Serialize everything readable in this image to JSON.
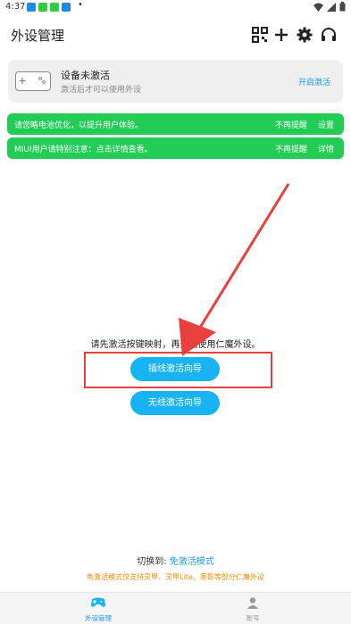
{
  "status_bar": {
    "time": "4:37",
    "app_colors": [
      "#1e88e5",
      "#2ecc40",
      "#2ecc40",
      "#1e88e5"
    ],
    "dot": "•",
    "right_icons": [
      "wifi-icon",
      "signal-icon",
      "battery-icon"
    ]
  },
  "header": {
    "title": "外设管理",
    "icons": [
      "qr-scan-icon",
      "add-icon",
      "gear-icon",
      "headset-icon"
    ]
  },
  "device_card": {
    "title": "设备未激活",
    "subtitle": "激活后才可以使用外设",
    "action": "开启激活",
    "icon": "gamepad-icon"
  },
  "banners": [
    {
      "message": "请您略电池优化，以提升用户体验。",
      "dismiss": "不再提醒",
      "action": "设置"
    },
    {
      "message": "MIUI用户请特别注意：点击详情查看。",
      "dismiss": "不再提醒",
      "action": "详情"
    }
  ],
  "main": {
    "prompt": "请先激活按键映射，再开始使用仁魔外设。",
    "wired_button": "插线激活向导",
    "wireless_button": "无线激活向导"
  },
  "switch": {
    "label": "切换到:",
    "mode": "免激活模式"
  },
  "note": "免激活模式仅支持灵甲、灵甲Lite、寒影等部分仁魔外设",
  "bottom_nav": [
    {
      "label": "外设管理",
      "icon": "gamepad-icon",
      "active": true
    },
    {
      "label": "账号",
      "icon": "person-icon",
      "active": false
    }
  ],
  "colors": {
    "accent": "#18b3f2",
    "link": "#1a9be8",
    "banner_green": "#22cc55",
    "annotation_red": "#e8403c",
    "note_orange": "#f08c00"
  }
}
